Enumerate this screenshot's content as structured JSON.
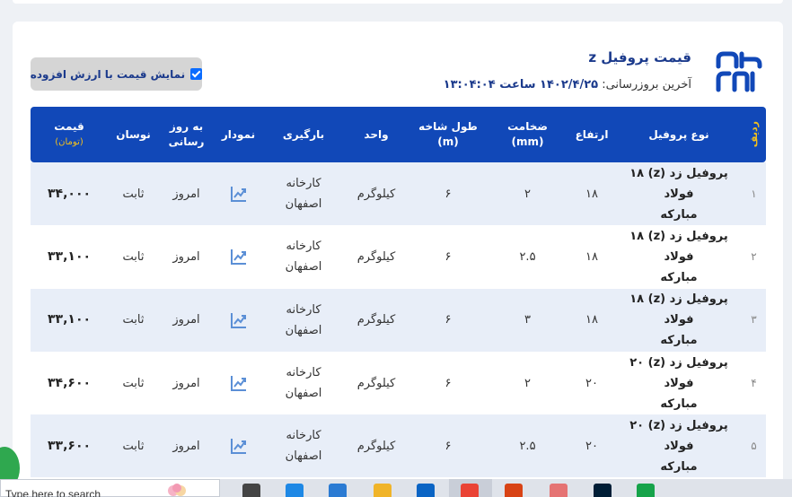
{
  "page": {
    "title": "قیمت پروفیل z",
    "last_update_label": "آخرین بروزرسانی:",
    "last_update_value": "۱۴۰۲/۴/۲۵ ساعت ۱۳:۰۴:۰۴",
    "vat_toggle_label": "نمایش قیمت با ارزش افزوده",
    "vat_checked": true
  },
  "table": {
    "headers": {
      "idx": "ردیف",
      "type": "نوع پروفیل",
      "height": "ارتفاع",
      "thickness_l1": "ضخامت",
      "thickness_l2": "(mm)",
      "length_l1": "طول شاخه",
      "length_l2": "(m)",
      "unit": "واحد",
      "loading": "بارگیری",
      "chart": "نمودار",
      "updated_l1": "به روز",
      "updated_l2": "رسانی",
      "oscillation": "نوسان",
      "price": "قیمت",
      "price_unit": "(تومان)"
    },
    "rows": [
      {
        "idx": "۱",
        "type_l1": "پروفیل زد (z) ۱۸ فولاد",
        "type_l2": "مبارکه",
        "height": "۱۸",
        "thickness": "۲",
        "length": "۶",
        "unit": "کیلوگرم",
        "loading_l1": "کارخانه",
        "loading_l2": "اصفهان",
        "updated": "امروز",
        "oscillation": "ثابت",
        "price": "۳۴,۰۰۰"
      },
      {
        "idx": "۲",
        "type_l1": "پروفیل زد (z) ۱۸ فولاد",
        "type_l2": "مبارکه",
        "height": "۱۸",
        "thickness": "۲.۵",
        "length": "۶",
        "unit": "کیلوگرم",
        "loading_l1": "کارخانه",
        "loading_l2": "اصفهان",
        "updated": "امروز",
        "oscillation": "ثابت",
        "price": "۳۳,۱۰۰"
      },
      {
        "idx": "۳",
        "type_l1": "پروفیل زد (z) ۱۸ فولاد",
        "type_l2": "مبارکه",
        "height": "۱۸",
        "thickness": "۳",
        "length": "۶",
        "unit": "کیلوگرم",
        "loading_l1": "کارخانه",
        "loading_l2": "اصفهان",
        "updated": "امروز",
        "oscillation": "ثابت",
        "price": "۳۳,۱۰۰"
      },
      {
        "idx": "۴",
        "type_l1": "پروفیل زد (z) ۲۰ فولاد",
        "type_l2": "مبارکه",
        "height": "۲۰",
        "thickness": "۲",
        "length": "۶",
        "unit": "کیلوگرم",
        "loading_l1": "کارخانه",
        "loading_l2": "اصفهان",
        "updated": "امروز",
        "oscillation": "ثابت",
        "price": "۳۴,۶۰۰"
      },
      {
        "idx": "۵",
        "type_l1": "پروفیل زد (z) ۲۰ فولاد",
        "type_l2": "مبارکه",
        "height": "۲۰",
        "thickness": "۲.۵",
        "length": "۶",
        "unit": "کیلوگرم",
        "loading_l1": "کارخانه",
        "loading_l2": "اصفهان",
        "updated": "امروز",
        "oscillation": "ثابت",
        "price": "۳۳,۶۰۰"
      }
    ]
  },
  "taskbar": {
    "search_text": "Type here to search",
    "apps": [
      "task-view-icon",
      "edge-icon",
      "store-icon",
      "file-explorer-icon",
      "mail-icon",
      "chrome-icon",
      "recorder-icon",
      "paint-icon",
      "photoshop-icon",
      "check-app-icon"
    ]
  },
  "icons": {
    "logo": "brand-logo",
    "chart": "chart-trend-icon"
  },
  "colors": {
    "brand_blue": "#1148b8",
    "accent_yellow": "#f2c01d",
    "row_alt": "#e8eef8"
  }
}
